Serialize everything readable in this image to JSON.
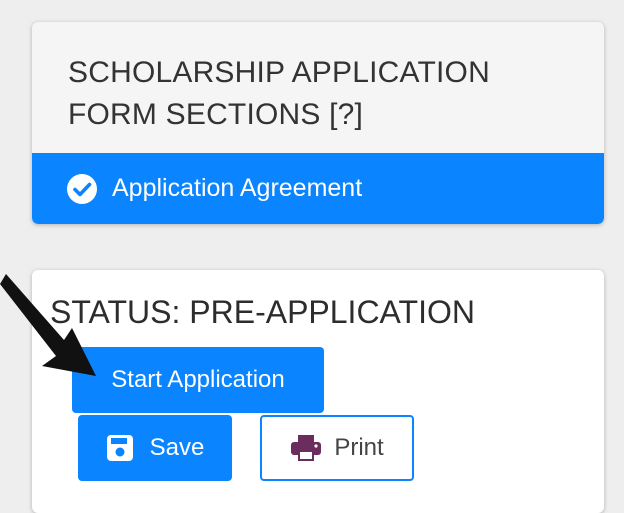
{
  "sections_panel": {
    "title": "SCHOLARSHIP APPLICATION FORM SECTIONS [?]",
    "items": [
      {
        "label": "Application Agreement",
        "icon": "check-circle-icon",
        "completed": true
      }
    ]
  },
  "status_panel": {
    "status_text": "STATUS: PRE-APPLICATION",
    "start_label": "Start Application",
    "save_label": "Save",
    "print_label": "Print"
  },
  "colors": {
    "accent": "#0a84ff",
    "print_icon": "#6b2c5e",
    "background": "#eeeeee"
  },
  "annotation": {
    "arrow_icon": "pointer-arrow-icon"
  }
}
